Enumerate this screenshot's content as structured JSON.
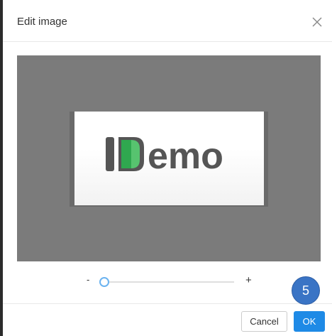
{
  "dialog": {
    "title": "Edit image"
  },
  "editor": {
    "logo_text": "emo"
  },
  "zoom": {
    "minus_label": "-",
    "plus_label": "+",
    "level": 0
  },
  "footer": {
    "cancel_label": "Cancel",
    "ok_label": "OK"
  },
  "annotation": {
    "step_number": "5"
  },
  "colors": {
    "accent": "#1e8ae6",
    "canvas_bg": "#7b7b7b",
    "logo_gray": "#555555",
    "logo_green": "#2fa84f",
    "badge": "#3a74c5"
  }
}
